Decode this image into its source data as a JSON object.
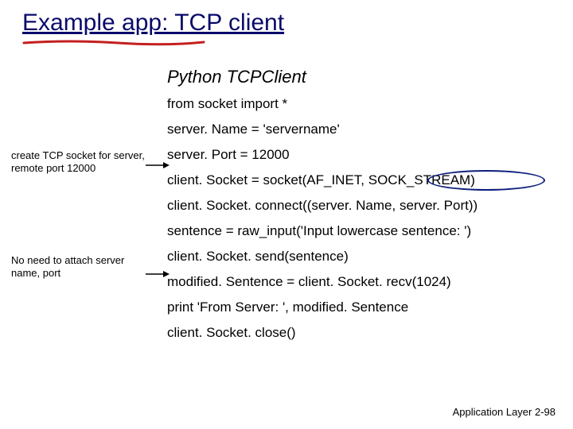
{
  "title": "Example  app: TCP client",
  "subtitle": "Python TCPClient",
  "code": {
    "l0": "from socket import *",
    "l1": "server. Name = 'servername'",
    "l2": "server. Port = 12000",
    "l3": "client. Socket = socket(AF_INET, SOCK_STREAM)",
    "l4": "client. Socket. connect((server. Name, server. Port))",
    "l5": "sentence = raw_input('Input lowercase sentence: ')",
    "l6": "client. Socket. send(sentence)",
    "l7": "modified. Sentence = client. Socket. recv(1024)",
    "l8": "print 'From Server: ', modified. Sentence",
    "l9": "client. Socket. close()"
  },
  "notes": {
    "n1": "create TCP socket for server, remote port 12000",
    "n2": "No need to attach server name, port"
  },
  "footer": "Application Layer 2-98"
}
